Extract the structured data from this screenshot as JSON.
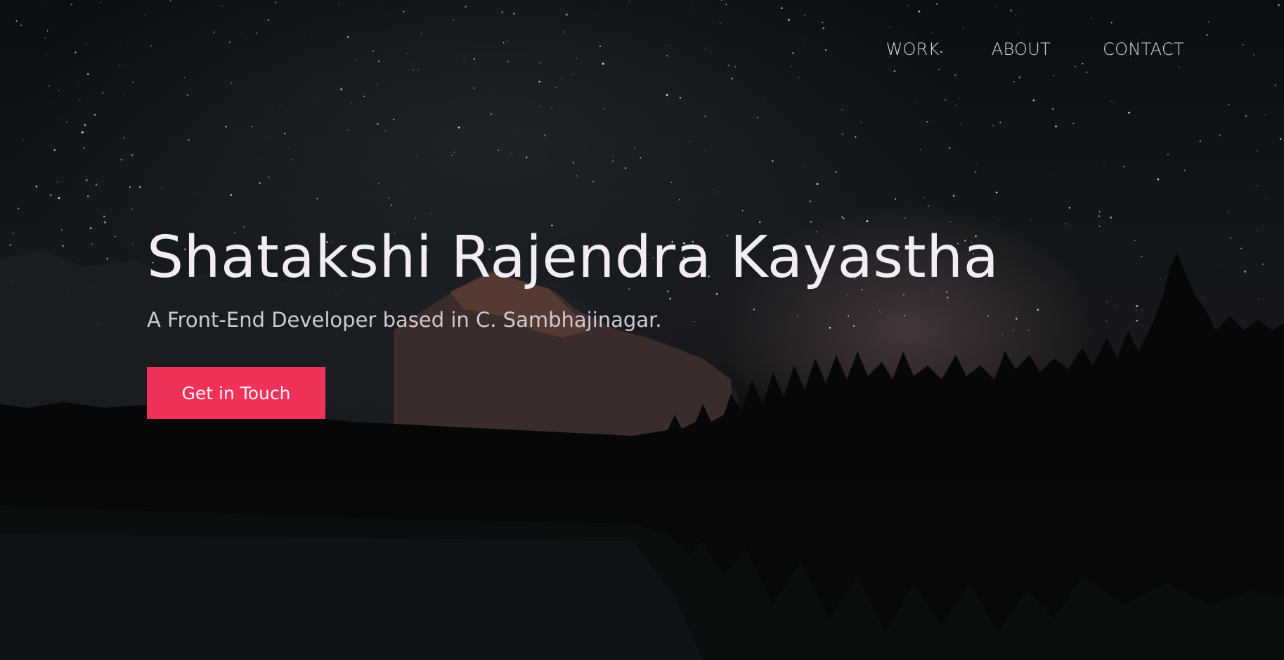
{
  "nav": {
    "items": [
      {
        "label": "WORK"
      },
      {
        "label": "ABOUT"
      },
      {
        "label": "CONTACT"
      }
    ]
  },
  "hero": {
    "title": "Shatakshi Rajendra Kayastha",
    "subtitle": "A Front-End Developer based in C. Sambhajinagar.",
    "cta_label": "Get in Touch"
  },
  "colors": {
    "accent": "#f0325a",
    "text_primary": "#f2edf5",
    "text_secondary": "#cfc9d3",
    "background": "#05070a"
  }
}
